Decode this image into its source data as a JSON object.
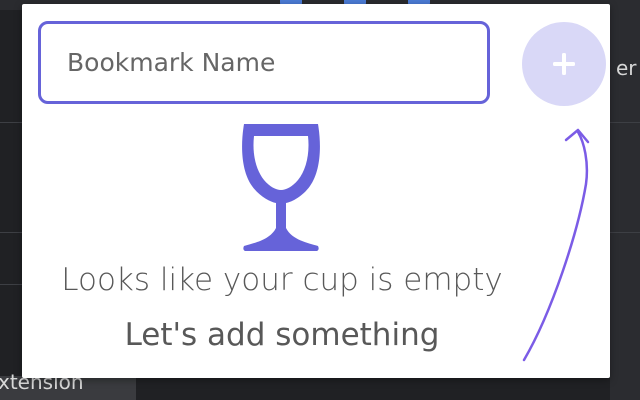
{
  "background": {
    "right_edge_text": "er",
    "bottom_left_text": "xtension"
  },
  "popup": {
    "bookmark_input": {
      "placeholder": "Bookmark Name",
      "value": ""
    },
    "add_button": {
      "icon": "plus-icon",
      "color": "#d9d8f7"
    },
    "empty_state": {
      "icon": "wine-glass-icon",
      "line1": "Looks like your cup is empty",
      "line2": "Let's add something"
    },
    "hint_arrow": {
      "icon": "curved-arrow-up-icon",
      "color": "#7b5ce6"
    },
    "accent_color": "#6663d9"
  }
}
